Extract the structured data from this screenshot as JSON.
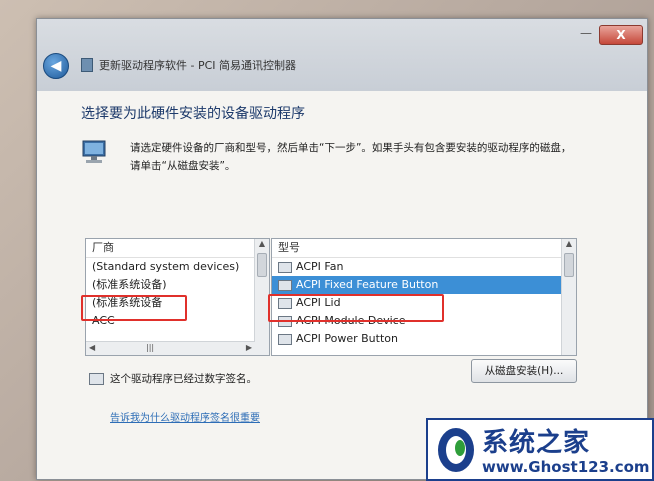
{
  "window": {
    "title": "更新驱动程序软件 - PCI 简易通讯控制器",
    "close_label": "X",
    "minimize_label": "—"
  },
  "main": {
    "heading": "选择要为此硬件安装的设备驱动程序",
    "instruction": "请选定硬件设备的厂商和型号，然后单击“下一步”。如果手头有包含要安装的驱动程序的磁盘，请单击“从磁盘安装”。"
  },
  "manufacturer_list": {
    "header": "厂商",
    "items": [
      "(Standard system devices)",
      "(标准系统设备)",
      "(标准系统设备",
      "ACC"
    ]
  },
  "model_list": {
    "header": "型号",
    "items": [
      "ACPI Fan",
      "ACPI Fixed Feature Button",
      "ACPI Lid",
      "ACPI Module Device",
      "ACPI Power Button"
    ]
  },
  "disk_button": {
    "label": "从磁盘安装(H)..."
  },
  "signature": {
    "text": "这个驱动程序已经过数字签名。",
    "link": "告诉我为什么驱动程序签名很重要"
  },
  "watermark": {
    "title": "系统之家",
    "url": "www.Ghost123.com"
  }
}
